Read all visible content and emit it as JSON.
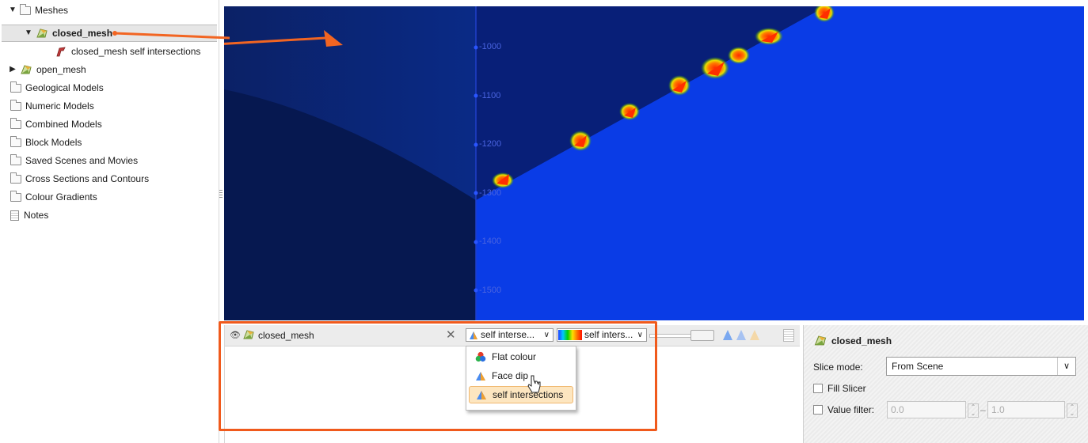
{
  "tree": {
    "items": [
      {
        "label": "Meshes",
        "expander": "▼",
        "icon": "folder-icon"
      },
      {
        "label": "closed_mesh",
        "expander": "▼",
        "icon": "mesh-icon"
      },
      {
        "label": "closed_mesh self intersections",
        "expander": "",
        "icon": "self-intersection-icon"
      },
      {
        "label": "open_mesh",
        "expander": "▶",
        "icon": "mesh-icon"
      },
      {
        "label": "Geological Models",
        "icon": "folder-icon"
      },
      {
        "label": "Numeric Models",
        "icon": "folder-icon"
      },
      {
        "label": "Combined Models",
        "icon": "folder-icon"
      },
      {
        "label": "Block Models",
        "icon": "folder-icon"
      },
      {
        "label": "Saved Scenes and Movies",
        "icon": "folder-icon"
      },
      {
        "label": "Cross Sections and Contours",
        "icon": "folder-icon"
      },
      {
        "label": "Colour Gradients",
        "icon": "folder-icon"
      },
      {
        "label": "Notes",
        "icon": "notes-icon"
      }
    ]
  },
  "scene": {
    "axis_ticks": [
      "-1000",
      "-1100",
      "-1200",
      "-1300",
      "-1400",
      "-1500"
    ],
    "colors": {
      "background": "#081c5a",
      "mesh": "#0a3ce6",
      "highlight": "#ff3c00",
      "arrow": "#f26522"
    }
  },
  "shapes_list": {
    "eye_icon": "eye-icon",
    "object_name": "closed_mesh",
    "colouring_selected": "self interse...",
    "colouring_options": [
      "Flat colour",
      "Face dip",
      "self intersections"
    ],
    "gradient_selected": "self inters..."
  },
  "properties": {
    "title": "closed_mesh",
    "slice_mode_label": "Slice mode:",
    "slice_mode_value": "From Scene",
    "fill_slicer_label": "Fill Slicer",
    "value_filter_label": "Value filter:",
    "value_filter_min": "0.0",
    "value_filter_max": "1.0",
    "range_separator": "–"
  }
}
